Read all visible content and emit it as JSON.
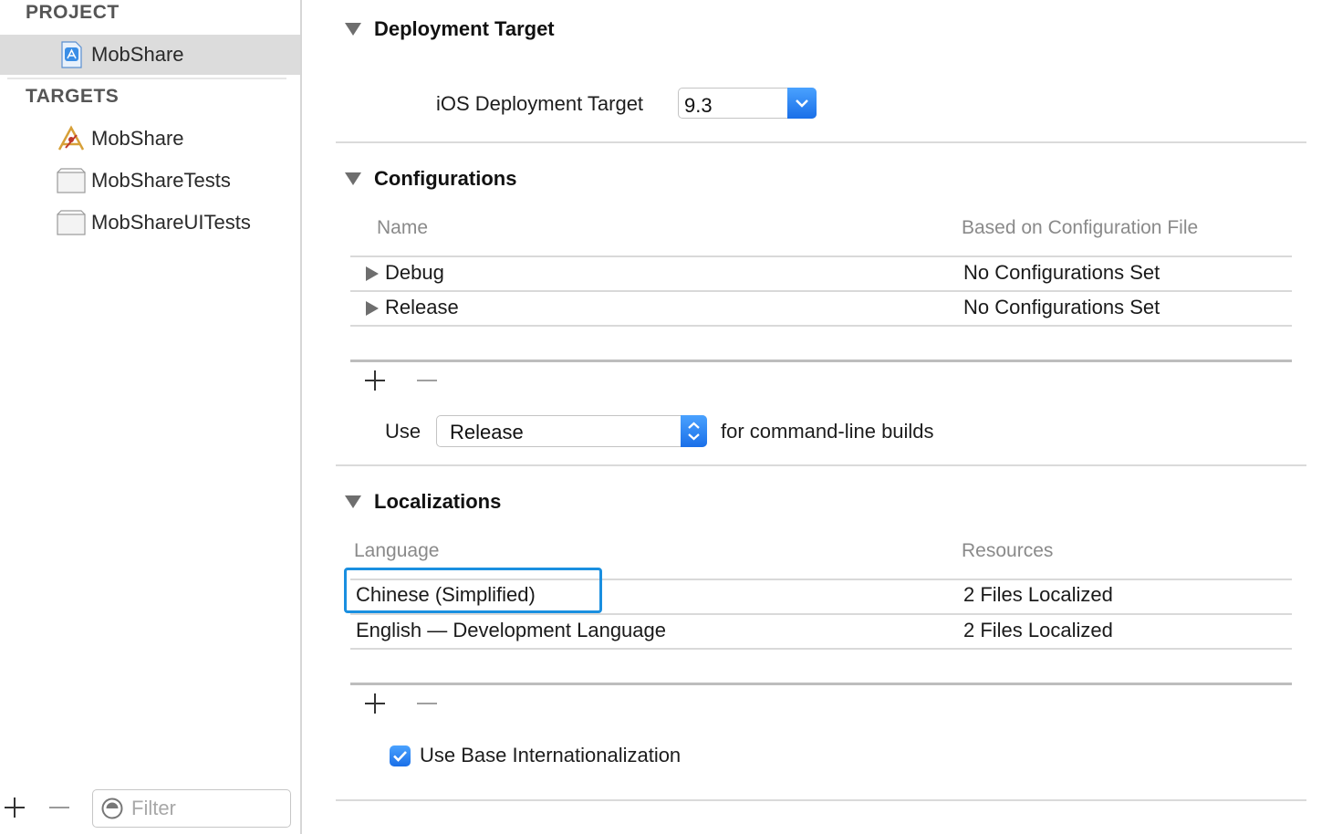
{
  "sidebar": {
    "project_header": "PROJECT",
    "project_items": [
      {
        "label": "MobShare",
        "icon": "app-project-icon",
        "selected": true
      }
    ],
    "targets_header": "TARGETS",
    "target_items": [
      {
        "label": "MobShare",
        "icon": "app-target-icon"
      },
      {
        "label": "MobShareTests",
        "icon": "bundle-icon"
      },
      {
        "label": "MobShareUITests",
        "icon": "bundle-icon"
      }
    ],
    "filter_placeholder": "Filter"
  },
  "deployment": {
    "title": "Deployment Target",
    "ios_label": "iOS Deployment Target",
    "ios_value": "9.3"
  },
  "configurations": {
    "title": "Configurations",
    "columns": [
      "Name",
      "Based on Configuration File"
    ],
    "rows": [
      {
        "name": "Debug",
        "file": "No Configurations Set"
      },
      {
        "name": "Release",
        "file": "No Configurations Set"
      }
    ],
    "use_label": "Use",
    "use_value": "Release",
    "use_suffix": "for command-line builds"
  },
  "localizations": {
    "title": "Localizations",
    "columns": [
      "Language",
      "Resources"
    ],
    "rows": [
      {
        "language": "Chinese (Simplified)",
        "resources": "2 Files Localized",
        "highlighted": true
      },
      {
        "language": "English — Development Language",
        "resources": "2 Files Localized"
      }
    ],
    "base_intl_label": "Use Base Internationalization",
    "base_intl_checked": true
  },
  "colors": {
    "accent": "#1a6fe8",
    "highlight": "#1a8fe0"
  }
}
